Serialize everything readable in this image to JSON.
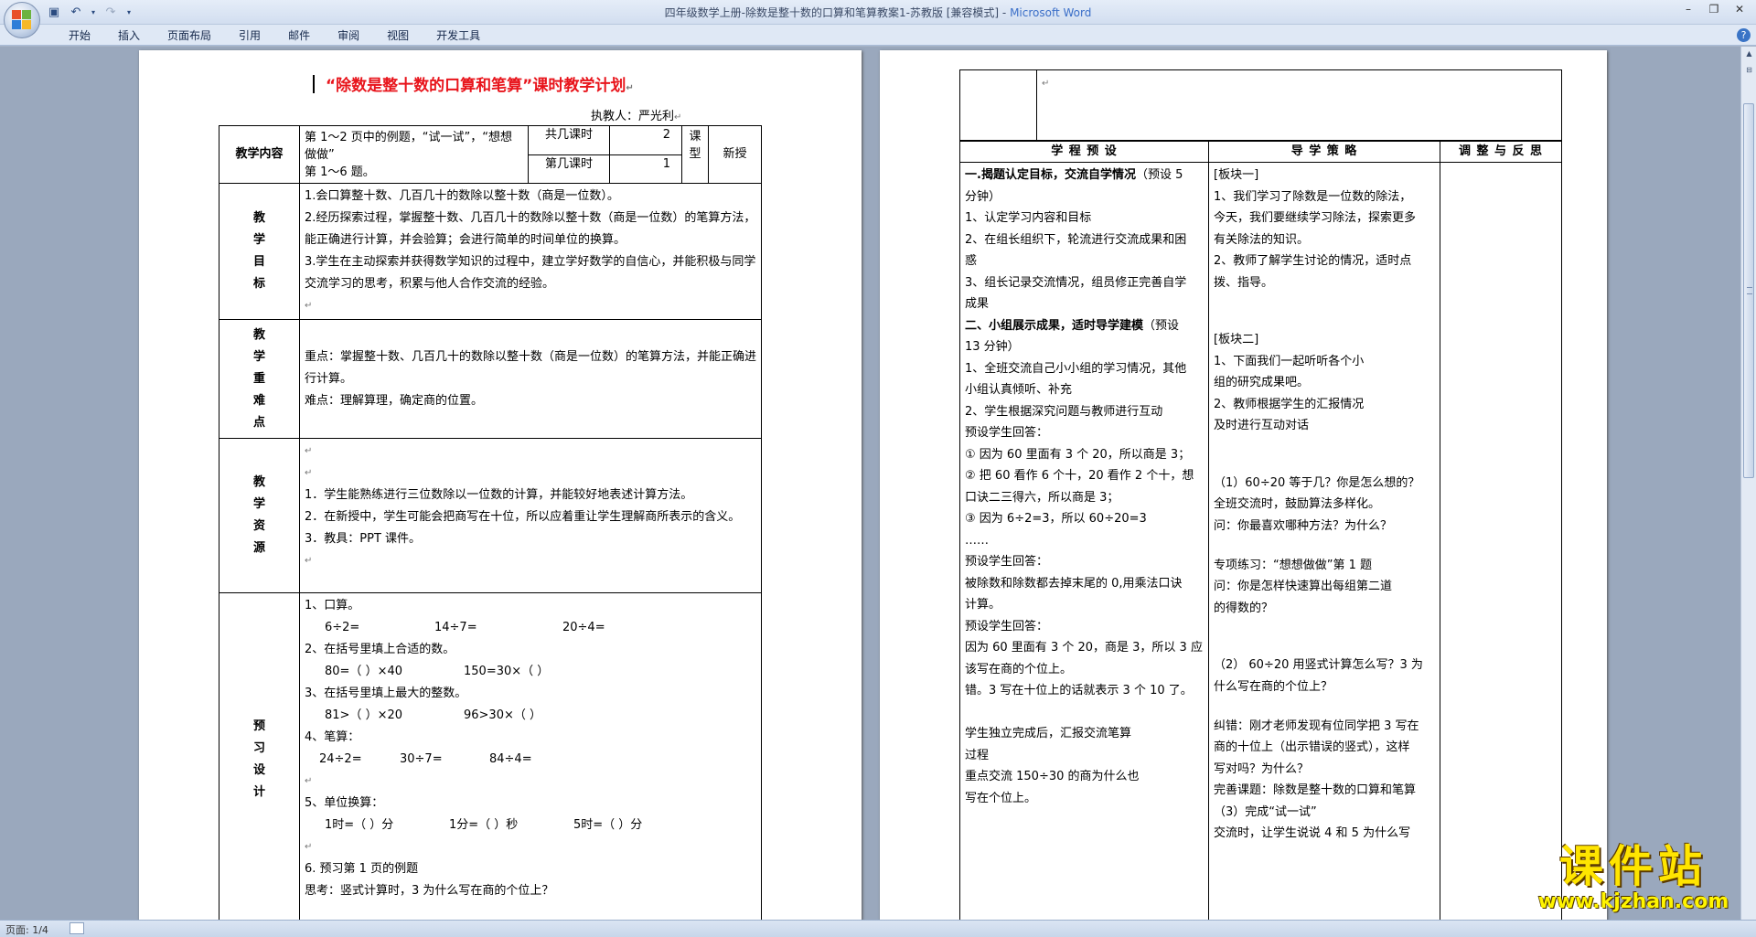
{
  "window": {
    "title_doc": "四年级数学上册-除数是整十数的口算和笔算教案1-苏教版 [兼容模式] - ",
    "title_app": "Microsoft Word"
  },
  "ribbon": {
    "tabs": [
      "开始",
      "插入",
      "页面布局",
      "引用",
      "邮件",
      "审阅",
      "视图",
      "开发工具"
    ]
  },
  "status": {
    "page": "页面: 1/4"
  },
  "page1": {
    "title": "“除数是整十数的口算和笔算”课时教学计划",
    "teacher": "执教人：严光利",
    "content_label": "教学内容",
    "content_line1": "第 1～2 页中的例题，“试一试”，“想想做做”",
    "content_line2": "第 1～6 题。",
    "total_label": "共几课时",
    "total_value": "2",
    "nth_label": "第几课时",
    "nth_value": "1",
    "type_label1": "课",
    "type_label2": "型",
    "type_value": "新授",
    "goals_label": [
      "教",
      "学",
      "目",
      "标"
    ],
    "goals": [
      "1.会口算整十数、几百几十的数除以整十数（商是一位数）。",
      "2.经历探索过程，掌握整十数、几百几十的数除以整十数（商是一位数）的笔算方法，能正确进行计算，并会验算；会进行简单的时间单位的换算。",
      "3.学生在主动探索并获得数学知识的过程中，建立学好数学的自信心，并能积极与同学交流学习的思考，积累与他人合作交流的经验。"
    ],
    "key_label": [
      "教",
      "学",
      "重",
      "难",
      "点"
    ],
    "key_points": [
      "重点：掌握整十数、几百几十的数除以整十数（商是一位数）的笔算方法，并能正确进行计算。",
      "难点：理解算理，确定商的位置。"
    ],
    "res_label": [
      "教",
      "学",
      "资",
      "源"
    ],
    "resources": [
      "1．学生能熟练进行三位数除以一位数的计算，并能较好地表述计算方法。",
      "2．在新授中，学生可能会把商写在十位，所以应着重让学生理解商所表示的含义。",
      "3．教具：PPT 课件。"
    ],
    "pre_label": [
      "预",
      "习",
      "设",
      "计"
    ],
    "pre": {
      "oral_title": "1、口算。",
      "oral": [
        "6÷2=",
        "14÷7=",
        "20÷4="
      ],
      "fill_title": "2、在括号里填上合适的数。",
      "fill": [
        "80=（  ）×40",
        "150=30×（  ）"
      ],
      "max_title": "3、在括号里填上最大的整数。",
      "max": [
        "81>（  ）×20",
        "96>30×（  ）"
      ],
      "written_title": "4、笔算：",
      "written": [
        "24÷2=",
        "30÷7=",
        "84÷4="
      ],
      "unit_title": "5、单位换算：",
      "unit": [
        "1时=（    ）分",
        "1分=（    ）秒",
        "5时=（    ）分"
      ],
      "preview_title": "6. 预习第 1 页的例题",
      "think": "思考：竖式计算时，3 为什么写在商的个位上？"
    }
  },
  "page2": {
    "col_headers": [
      "学 程 预 设",
      "导 学 策 略",
      "调 整 与 反 思"
    ],
    "left": [
      {
        "text": "一.揭题认定目标，交流自学情况",
        "bold": true,
        "suffix": "（预设 5"
      },
      {
        "text": "分钟）"
      },
      {
        "text": "1、认定学习内容和目标"
      },
      {
        "text": "2、在组长组织下，轮流进行交流成果和困"
      },
      {
        "text": "惑"
      },
      {
        "text": "3、组长记录交流情况，组员修正完善自学"
      },
      {
        "text": "成果"
      },
      {
        "text": "二、小组展示成果，适时导学建模",
        "bold": true,
        "suffix": "（预设"
      },
      {
        "text": "13 分钟）"
      },
      {
        "text": "1、全班交流自己小小组的学习情况，其他"
      },
      {
        "text": "小组认真倾听、补充"
      },
      {
        "text": "2、学生根据深究问题与教师进行互动"
      },
      {
        "text": "    预设学生回答："
      },
      {
        "text": "①  因为 60 里面有 3 个 20，所以商是 3；"
      },
      {
        "text": "②  把 60 看作 6 个十，20 看作 2 个十，想"
      },
      {
        "text": "    口诀二三得六，所以商是 3；"
      },
      {
        "text": "③  因为 6÷2=3，所以 60÷20=3"
      },
      {
        "text": "      ……"
      },
      {
        "text": "预设学生回答："
      },
      {
        "text": "被除数和除数都去掉末尾的 0,用乘法口诀"
      },
      {
        "text": "计算。"
      },
      {
        "text": "预设学生回答："
      },
      {
        "text": "因为 60 里面有 3 个 20，商是 3，所以 3 应"
      },
      {
        "text": "该写在商的个位上。"
      },
      {
        "text": "错。3 写在十位上的话就表示 3 个 10 了。"
      },
      {
        "text": ""
      },
      {
        "text": "    学生独立完成后，汇报交流笔算"
      },
      {
        "text": "过程"
      },
      {
        "text": "    重点交流 150÷30 的商为什么也"
      },
      {
        "text": "写在个位上。"
      }
    ],
    "middle": [
      "[板块一]",
      "1、我们学习了除数是一位数的除法，",
      "今天，我们要继续学习除法，探索更多",
      "有关除法的知识。",
      "2、教师了解学生讨论的情况，适时点",
      "拨、指导。",
      "",
      "",
      "[板块二]",
      "1、下面我们一起听听各个小",
      "组的研究成果吧。",
      "2、教师根据学生的汇报情况",
      "及时进行互动对话",
      "",
      "",
      "（1）60÷20 等于几？你是怎么想的？",
      "全班交流时，鼓励算法多样化。",
      "问：你最喜欢哪种方法？为什么？",
      "",
      "专项练习：“想想做做”第 1 题",
      "    问：你是怎样快速算出每组第二道",
      "的得数的？",
      "",
      "",
      "（2） 60÷20 用竖式计算怎么写？3 为",
      "什么写在商的个位上？",
      "",
      "纠错：刚才老师发现有位同学把 3 写在",
      "商的十位上（出示错误的竖式），这样",
      "写对吗？为什么？",
      "完善课题：除数是整十数的口算和笔算",
      "（3）完成“试一试”",
      "  交流时，让学生说说 4 和 5 为什么写"
    ]
  },
  "watermark": {
    "big": "课件站",
    "url": "www.kjzhan.com"
  }
}
